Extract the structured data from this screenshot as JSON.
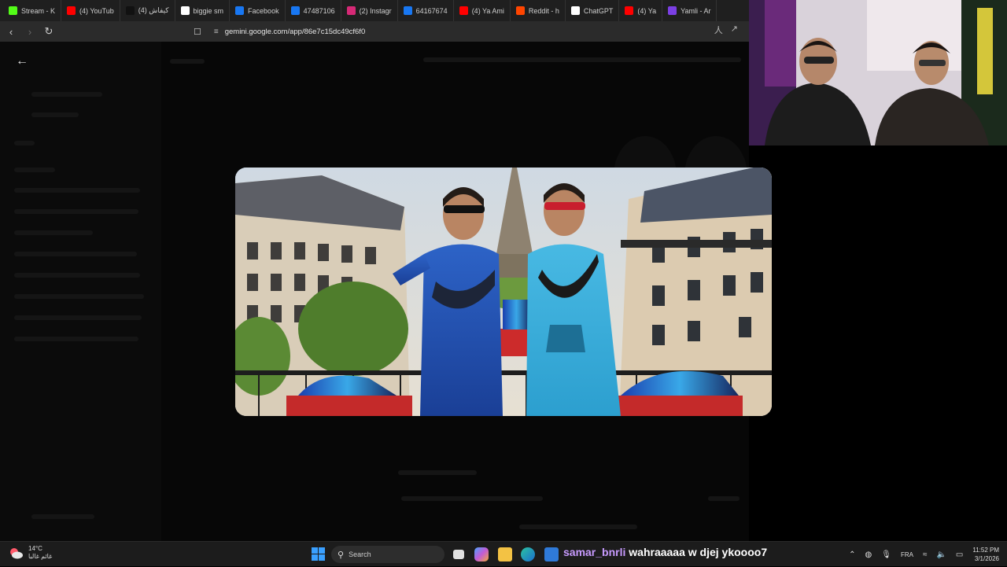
{
  "browser": {
    "tabs": [
      {
        "label": "Stream - K",
        "icon": "kick-icon",
        "color": "#53fc18"
      },
      {
        "label": "(4) YouTub",
        "icon": "youtube-icon",
        "color": "#ff0000"
      },
      {
        "label": "كيفاش (4)",
        "icon": "tiktok-icon",
        "color": "#111111"
      },
      {
        "label": "biggie sm",
        "icon": "google-icon",
        "color": "#ffffff"
      },
      {
        "label": "Facebook",
        "icon": "facebook-icon",
        "color": "#1877f2"
      },
      {
        "label": "47487106",
        "icon": "facebook-icon",
        "color": "#1877f2"
      },
      {
        "label": "(2) Instagr",
        "icon": "instagram-icon",
        "color": "#d62976"
      },
      {
        "label": "64167674",
        "icon": "facebook-icon",
        "color": "#1877f2"
      },
      {
        "label": "(4) Ya Ami",
        "icon": "youtube-icon",
        "color": "#ff0000"
      },
      {
        "label": "Reddit - h",
        "icon": "reddit-icon",
        "color": "#ff4500"
      },
      {
        "label": "ChatGPT",
        "icon": "chatgpt-icon",
        "color": "#ffffff"
      },
      {
        "label": "(4) Ya",
        "icon": "youtube-icon",
        "color": "#ff0000"
      },
      {
        "label": "Yamli - Ar",
        "icon": "yamli-icon",
        "color": "#7b3fe4"
      }
    ],
    "url": "gemini.google.com/app/86e7c15dc49cf6f0"
  },
  "taskbar": {
    "weather_temp": "14°C",
    "weather_desc": "غائم غالبا",
    "search_label": "Search",
    "chat_user": "samar_bnrli",
    "chat_message": "wahraaaaa w djej ykoooo7",
    "language": "FRA",
    "time": "11:52 PM",
    "date": "3/1/2026"
  }
}
